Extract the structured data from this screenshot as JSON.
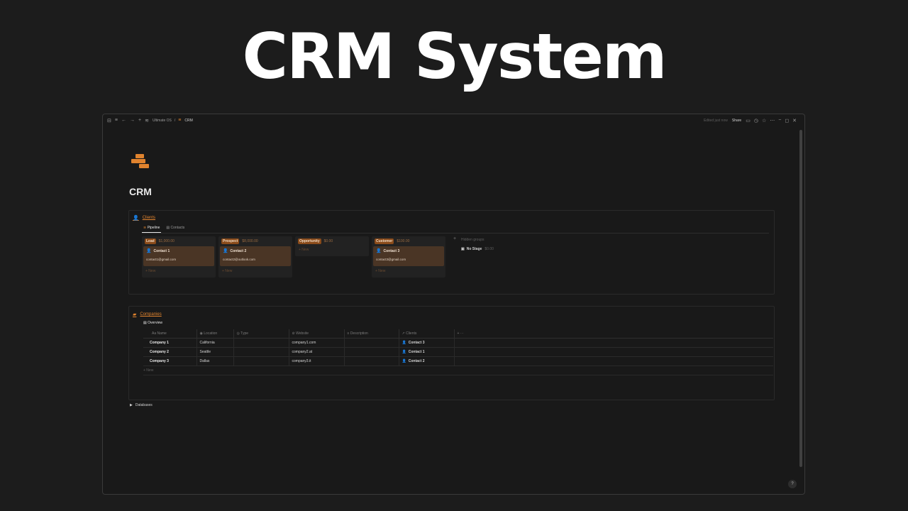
{
  "hero": {
    "title": "CRM System"
  },
  "topbar": {
    "breadcrumbs": [
      "Ultimate OS",
      "/",
      "CRM"
    ],
    "edited": "Edited just now",
    "share": "Share"
  },
  "page": {
    "title": "CRM"
  },
  "clients": {
    "title": "Clients",
    "tabs": [
      "Pipeline",
      "Contacts"
    ],
    "columns": [
      {
        "stage": "Lead",
        "amount": "$1,000.00",
        "card": {
          "name": "Contact 1",
          "email": "contact1@gmail.com"
        },
        "new": "+ New"
      },
      {
        "stage": "Prospect",
        "amount": "$8,000.00",
        "card": {
          "name": "Contact 2",
          "email": "contact2@outlook.com"
        },
        "new": "+ New"
      },
      {
        "stage": "Opportunity",
        "amount": "$0.00",
        "new": "+ New"
      },
      {
        "stage": "Customer",
        "amount": "$100.00",
        "card": {
          "name": "Contact 3",
          "email": "contact3@gmail.com"
        },
        "new": "+ New"
      }
    ],
    "hidden_groups": {
      "label": "Hidden groups",
      "stage": "No Stage",
      "amount": "$0.00"
    }
  },
  "companies": {
    "title": "Companies",
    "view": "Overview",
    "headers": [
      "Aa Name",
      "Location",
      "Type",
      "Website",
      "Description",
      "Clients"
    ],
    "rows": [
      {
        "name": "Company 1",
        "location": "California",
        "type": "",
        "website": "company1.com",
        "description": "",
        "client": "Contact 3"
      },
      {
        "name": "Company 2",
        "location": "Seattle",
        "type": "",
        "website": "company2.at",
        "description": "",
        "client": "Contact 1"
      },
      {
        "name": "Company 3",
        "location": "Dallas",
        "type": "",
        "website": "company3.it",
        "description": "",
        "client": "Contact 2"
      }
    ],
    "new": "+ New"
  },
  "databases": {
    "label": "Databases"
  },
  "colors": {
    "accent": "#e0832e",
    "background": "#191919",
    "card": "#4a3525"
  }
}
